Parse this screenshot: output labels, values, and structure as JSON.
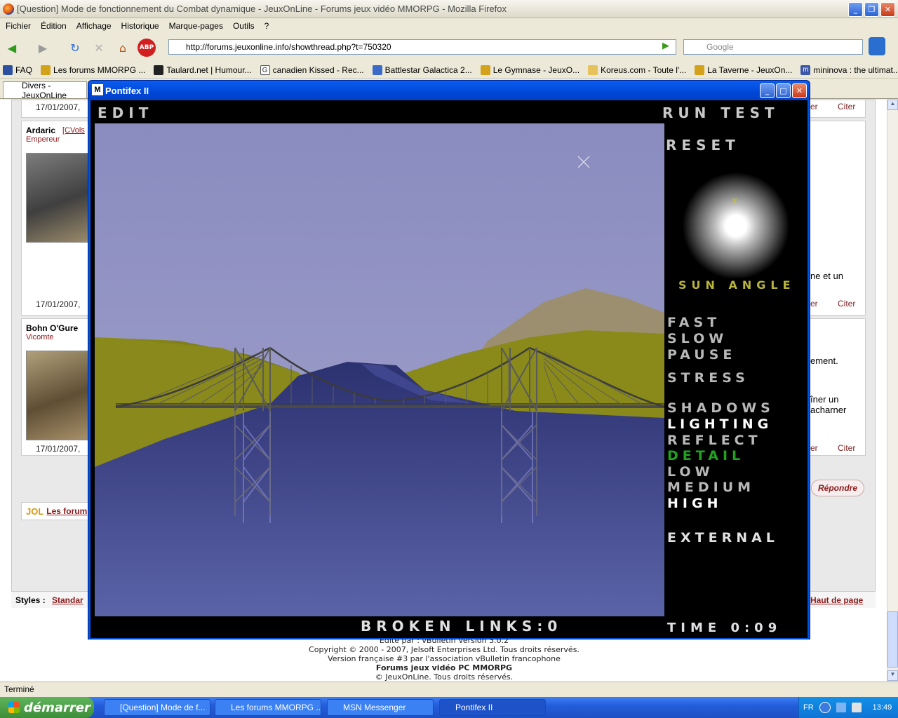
{
  "firefox": {
    "title": "[Question] Mode de fonctionnement du Combat dynamique - JeuxOnLine - Forums jeux vidéo MMORPG - Mozilla Firefox",
    "menu": [
      "Fichier",
      "Édition",
      "Affichage",
      "Historique",
      "Marque-pages",
      "Outils",
      "?"
    ],
    "url": "http://forums.jeuxonline.info/showthread.php?t=750320",
    "search_placeholder": "Google",
    "bookmarks": [
      "FAQ",
      "Les forums MMORPG ...",
      "Taulard.net | Humour...",
      "canadien Kissed - Rec...",
      "Battlestar Galactica 2...",
      "Le Gymnase - JeuxO...",
      "Koreus.com - Toute l'...",
      "La Taverne - JeuxOn...",
      "mininova : the ultimat..."
    ],
    "tab_label": "Divers - JeuxOnLine",
    "status": "Terminé"
  },
  "forum": {
    "posts": [
      {
        "user": "",
        "rank": "",
        "date": "17/01/2007,",
        "side_text": ""
      },
      {
        "user": "Ardaric",
        "tag": "[CVols",
        "rank": "Empereur",
        "date": "17/01/2007,",
        "side_text": "ne et un"
      },
      {
        "user": "Bohn O'Gure",
        "tag": "",
        "rank": "Vicomte",
        "date": "17/01/2007,",
        "side_text": "ement."
      }
    ],
    "side_text_extra": [
      "îner un",
      "acharner"
    ],
    "cite_label": "Citer",
    "cite_prefix": "er",
    "reply_label": "Répondre",
    "forum_link": "Les forum",
    "styles_label": "Styles :",
    "styles_value": "Standar",
    "top_link": "Haut de page",
    "footer": [
      "Edité par : vBulletin Version 3.0.2",
      "Copyright © 2000 - 2007, Jelsoft Enterprises Ltd. Tous droits réservés.",
      "Version française #3 par l'association vBulletin francophone",
      "Forums jeux vidéo PC MMORPG",
      "© JeuxOnLine. Tous droits réservés."
    ]
  },
  "pontifex": {
    "window_title": "Pontifex II",
    "edit": "EDIT",
    "run_test": "RUN TEST",
    "reset": "RESET",
    "sun_angle": "SUN ANGLE",
    "fast": "FAST",
    "slow": "SLOW",
    "pause": "PAUSE",
    "stress": "STRESS",
    "shadows": "SHADOWS",
    "lighting": "LIGHTING",
    "reflect": "REFLECT",
    "detail": "DETAIL",
    "low": "LOW",
    "medium": "MEDIUM",
    "high": "HIGH",
    "external": "EXTERNAL",
    "broken_links": "BROKEN LINKS:0",
    "time": "TIME 0:09",
    "colors": {
      "sky": "#8a8cc0",
      "water": "#3a3f8a",
      "hills": "#8b8a18",
      "detail_green": "#1fa31f",
      "sun_angle": "#b8b43a"
    }
  },
  "taskbar": {
    "start": "démarrer",
    "tasks": [
      "[Question] Mode de f...",
      "Les forums MMORPG ...",
      "MSN Messenger",
      "Pontifex II"
    ],
    "lang": "FR",
    "clock": "13:49"
  }
}
